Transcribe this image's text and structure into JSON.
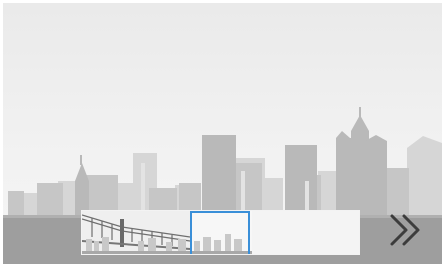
{
  "viewer": {
    "scene": "city-skyline-panorama"
  },
  "panorama_strip": {
    "thumbnail": "panorama-thumbnail",
    "selection": "current-view-selection"
  },
  "controls": {
    "next_icon": "double-chevron-right-icon"
  },
  "colors": {
    "sky_top": "#e9e9e9",
    "sky_bottom": "#f7f7f7",
    "building_dark": "#bdbdbd",
    "building_light": "#d8d8d8",
    "ground": "#9b9b9b",
    "selection_border": "#3a8fd8",
    "icon": "#3c3c3c"
  }
}
